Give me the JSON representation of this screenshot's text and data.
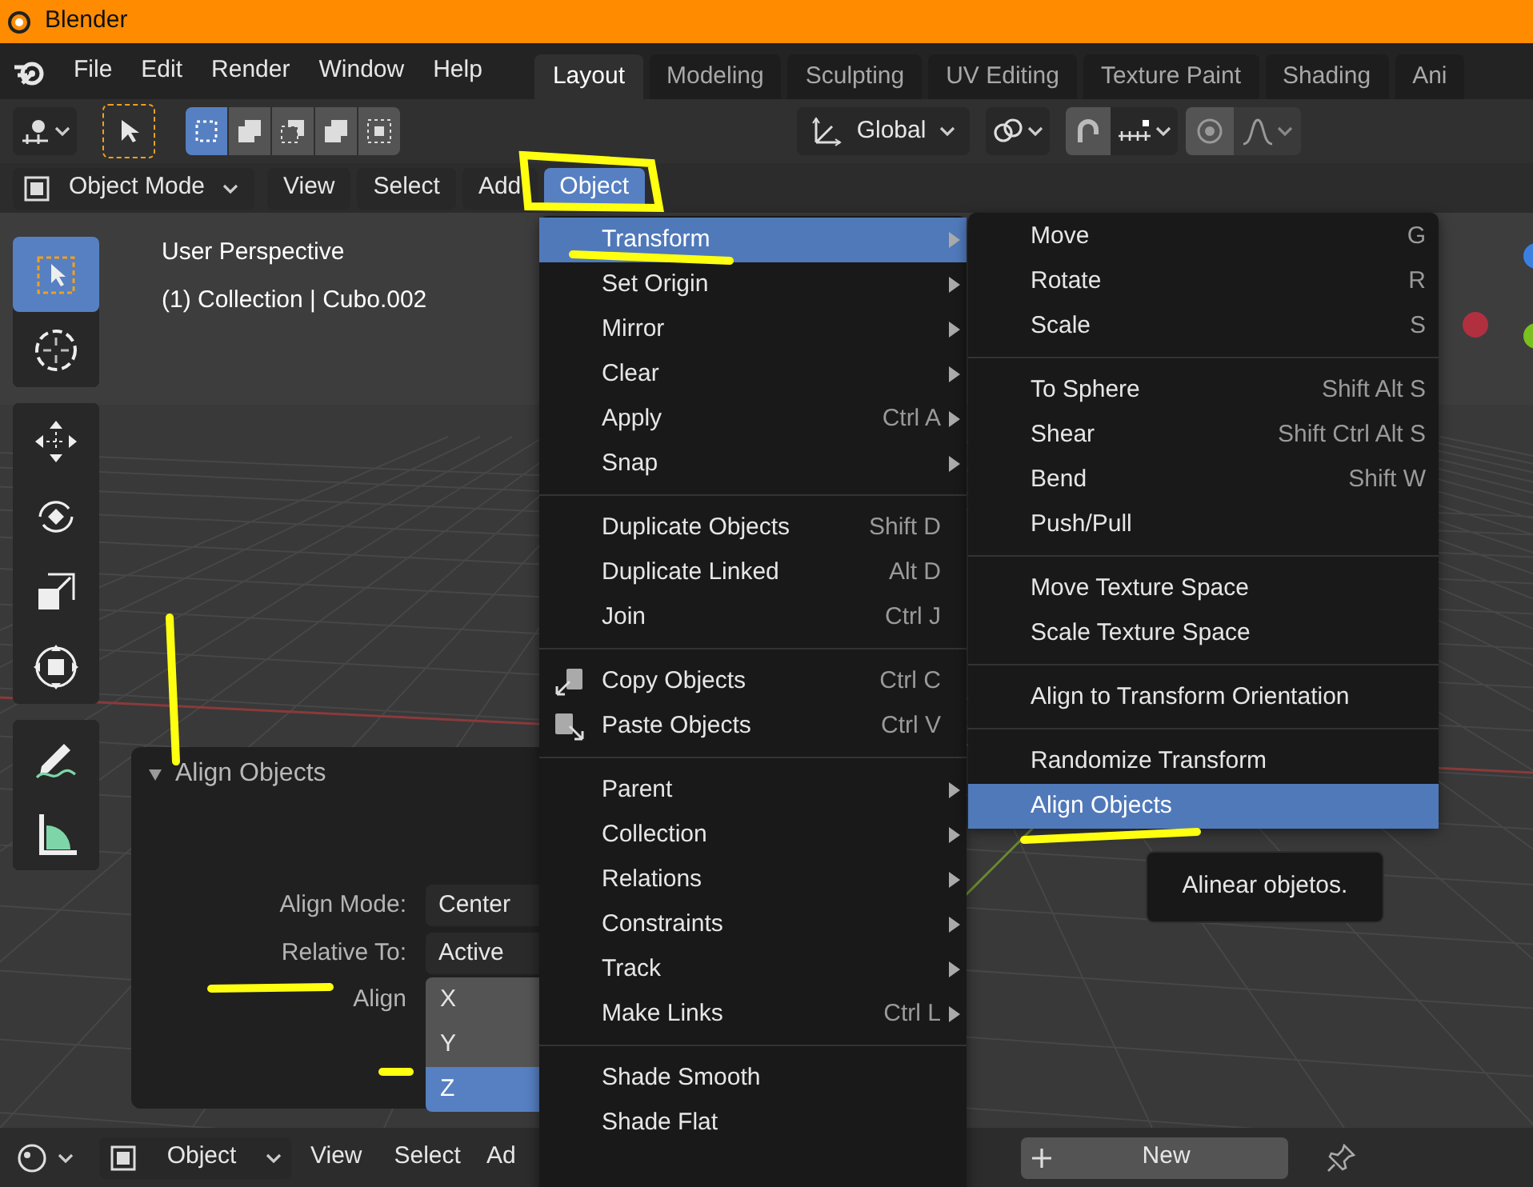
{
  "window": {
    "title": "Blender"
  },
  "menu_bar": [
    "File",
    "Edit",
    "Render",
    "Window",
    "Help"
  ],
  "workspace_tabs": [
    {
      "label": "Layout",
      "selected": true
    },
    {
      "label": "Modeling",
      "selected": false
    },
    {
      "label": "Sculpting",
      "selected": false
    },
    {
      "label": "UV Editing",
      "selected": false
    },
    {
      "label": "Texture Paint",
      "selected": false
    },
    {
      "label": "Shading",
      "selected": false
    },
    {
      "label": "Ani",
      "selected": false
    }
  ],
  "tool_header": {
    "select_modes": [
      {
        "selected": true
      },
      {
        "selected": false
      },
      {
        "selected": false
      },
      {
        "selected": false
      },
      {
        "selected": false
      }
    ],
    "orientation": "Global"
  },
  "viewport_header": {
    "mode": "Object Mode",
    "menus": [
      {
        "label": "View",
        "selected": false
      },
      {
        "label": "Select",
        "selected": false
      },
      {
        "label": "Add",
        "selected": false
      },
      {
        "label": "Object",
        "selected": true
      }
    ]
  },
  "toolbar": [
    {
      "selected": true
    },
    {
      "selected": false
    },
    {
      "selected": false
    },
    {
      "selected": false
    },
    {
      "selected": false
    },
    {
      "selected": false
    },
    {
      "selected": false
    },
    {
      "selected": false
    }
  ],
  "viewport": {
    "overlay_lines": [
      "User Perspective",
      "(1) Collection | Cubo.002"
    ]
  },
  "operator_panel": {
    "title": "Align Objects",
    "expanded": true,
    "fields": [
      {
        "label": "Align Mode:",
        "value": "Center"
      },
      {
        "label": "Relative To:",
        "value": "Active"
      }
    ],
    "align": {
      "label": "Align",
      "axes": [
        {
          "label": "X",
          "selected": false
        },
        {
          "label": "Y",
          "selected": false
        },
        {
          "label": "Z",
          "selected": true
        }
      ]
    }
  },
  "object_menu": {
    "sections": [
      [
        {
          "label": "Transform",
          "submenu": true,
          "selected": true
        },
        {
          "label": "Set Origin",
          "submenu": true,
          "selected": false
        },
        {
          "label": "Mirror",
          "submenu": true,
          "selected": false
        },
        {
          "label": "Clear",
          "submenu": true,
          "selected": false
        },
        {
          "label": "Apply",
          "shortcut": "Ctrl A",
          "submenu": true,
          "selected": false
        },
        {
          "label": "Snap",
          "submenu": true,
          "selected": false
        }
      ],
      [
        {
          "label": "Duplicate Objects",
          "shortcut": "Shift D",
          "submenu": false,
          "selected": false
        },
        {
          "label": "Duplicate Linked",
          "shortcut": "Alt D",
          "submenu": false,
          "selected": false
        },
        {
          "label": "Join",
          "shortcut": "Ctrl J",
          "submenu": false,
          "selected": false
        }
      ],
      [
        {
          "label": "Copy Objects",
          "shortcut": "Ctrl C",
          "submenu": false,
          "selected": false
        },
        {
          "label": "Paste Objects",
          "shortcut": "Ctrl V",
          "submenu": false,
          "selected": false
        }
      ],
      [
        {
          "label": "Parent",
          "submenu": true,
          "selected": false
        },
        {
          "label": "Collection",
          "submenu": true,
          "selected": false
        },
        {
          "label": "Relations",
          "submenu": true,
          "selected": false
        },
        {
          "label": "Constraints",
          "submenu": true,
          "selected": false
        },
        {
          "label": "Track",
          "submenu": true,
          "selected": false
        },
        {
          "label": "Make Links",
          "shortcut": "Ctrl L",
          "submenu": true,
          "selected": false
        }
      ],
      [
        {
          "label": "Shade Smooth",
          "submenu": false,
          "selected": false
        },
        {
          "label": "Shade Flat",
          "submenu": false,
          "selected": false
        }
      ]
    ]
  },
  "transform_submenu": {
    "sections": [
      [
        {
          "label": "Move",
          "shortcut": "G",
          "selected": false
        },
        {
          "label": "Rotate",
          "shortcut": "R",
          "selected": false
        },
        {
          "label": "Scale",
          "shortcut": "S",
          "selected": false
        }
      ],
      [
        {
          "label": "To Sphere",
          "shortcut": "Shift Alt S",
          "selected": false
        },
        {
          "label": "Shear",
          "shortcut": "Shift Ctrl Alt S",
          "selected": false
        },
        {
          "label": "Bend",
          "shortcut": "Shift W",
          "selected": false
        },
        {
          "label": "Push/Pull",
          "selected": false
        }
      ],
      [
        {
          "label": "Move Texture Space",
          "selected": false
        },
        {
          "label": "Scale Texture Space",
          "selected": false
        }
      ],
      [
        {
          "label": "Align to Transform Orientation",
          "selected": false
        }
      ],
      [
        {
          "label": "Randomize Transform",
          "selected": false
        },
        {
          "label": "Align Objects",
          "selected": true
        }
      ]
    ]
  },
  "tooltip": "Alinear objetos.",
  "bottom_header": {
    "mode": "Object",
    "menus": [
      "View",
      "Select",
      "Ad"
    ],
    "new_button": "New"
  }
}
